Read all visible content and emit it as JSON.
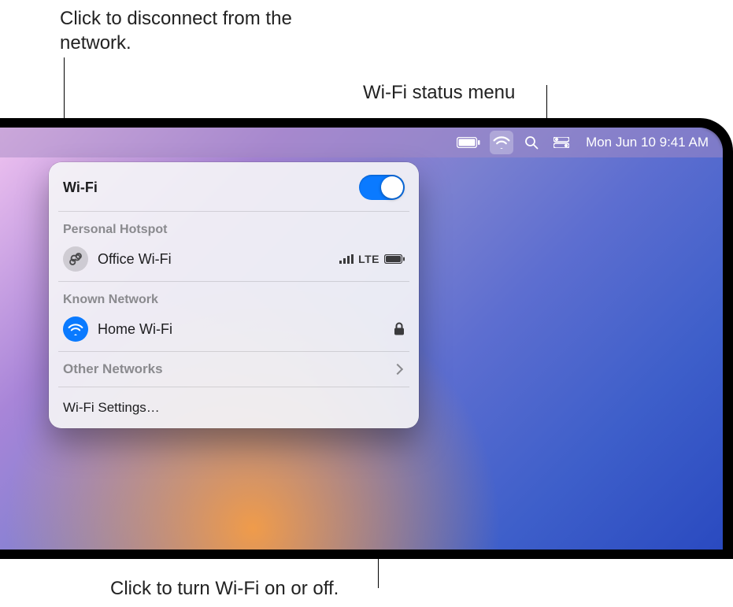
{
  "callouts": {
    "disconnect": "Click to disconnect from the network.",
    "status_menu": "Wi-Fi status menu",
    "toggle": "Click to turn Wi-Fi on or off."
  },
  "menubar": {
    "clock": "Mon Jun 10  9:41 AM"
  },
  "popover": {
    "title": "Wi-Fi",
    "sections": {
      "hotspot_title": "Personal Hotspot",
      "hotspot_item": "Office Wi-Fi",
      "hotspot_band": "LTE",
      "known_title": "Known Network",
      "known_item": "Home Wi-Fi",
      "other_title": "Other Networks",
      "settings": "Wi-Fi Settings…"
    }
  }
}
